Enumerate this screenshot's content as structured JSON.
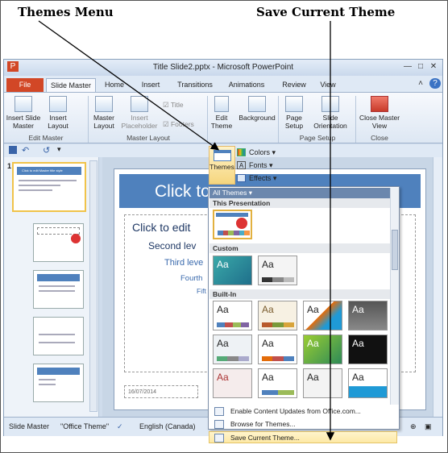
{
  "callouts": {
    "themes_menu": "Themes Menu",
    "save_current_theme": "Save Current Theme"
  },
  "window": {
    "title": "Title Slide2.pptx - Microsoft PowerPoint"
  },
  "tabs": [
    "File",
    "Slide Master",
    "Home",
    "Insert",
    "Transitions",
    "Animations",
    "Review",
    "View"
  ],
  "ribbon": {
    "insert_slide_master": "Insert Slide Master",
    "insert_layout": "Insert Layout",
    "group_edit_master": "Edit Master",
    "master_layout": "Master Layout",
    "insert_placeholder": "Insert Placeholder",
    "title_check": "Title",
    "footers_check": "Footers",
    "group_master_layout": "Master Layout",
    "edit_theme": "Edit Theme",
    "background": "Background",
    "page_setup": "Page Setup",
    "slide_orientation": "Slide Orientation",
    "group_page_setup": "Page Setup",
    "close_master_view": "Close Master View",
    "group_close": "Close"
  },
  "themes_button": "Themes",
  "theme_submenu": {
    "colors": "Colors",
    "fonts": "Fonts",
    "effects": "Effects"
  },
  "slide": {
    "title": "Click to",
    "bullet1": "Click to edit",
    "bullet2": "Second lev",
    "bullet3": "Third leve",
    "bullet4": "Fourth",
    "bullet5": "Fift",
    "footer_date": "16/07/2014",
    "thumb1_title": "Click to edit Master title style"
  },
  "gallery": {
    "header": "All Themes",
    "section_this": "This Presentation",
    "section_custom": "Custom",
    "section_builtin": "Built-In",
    "aa": "Aa"
  },
  "menu_items": {
    "enable_updates": "Enable Content Updates from Office.com...",
    "browse": "Browse for Themes...",
    "save_current": "Save Current Theme..."
  },
  "status": {
    "view": "Slide Master",
    "theme": "\"Office Theme\"",
    "language": "English (Canada)"
  },
  "colors": {
    "file_tab": "#d24726",
    "title_bar": "#4f81bd",
    "highlight": "#fde9a6"
  }
}
